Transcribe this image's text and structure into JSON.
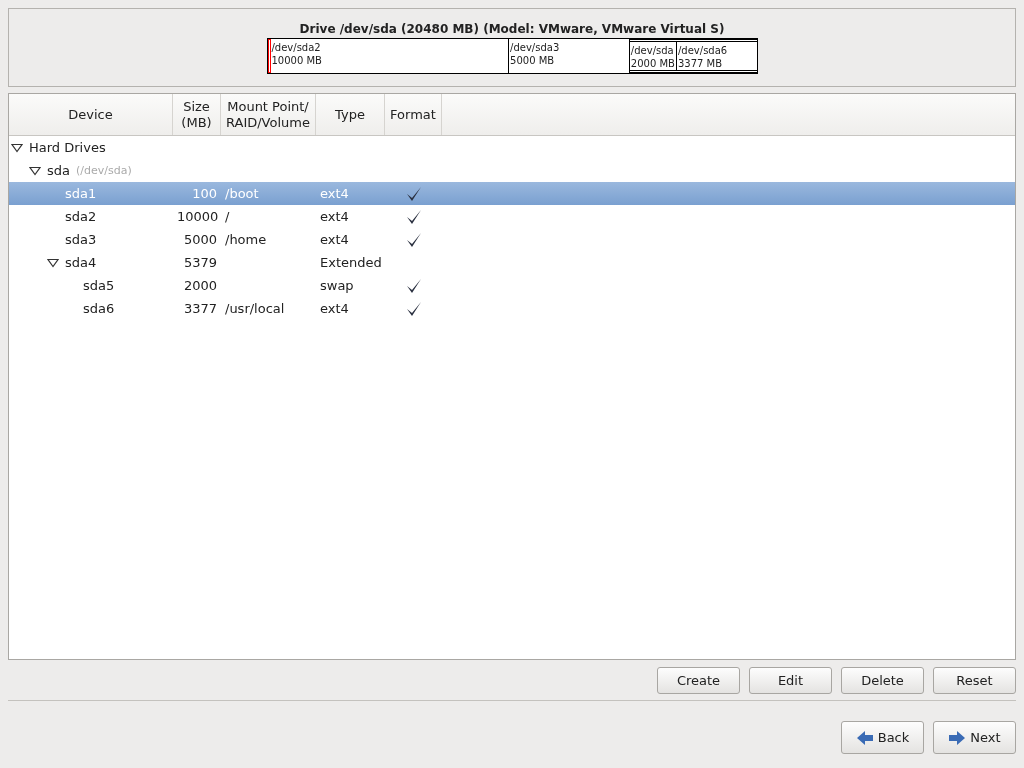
{
  "drive": {
    "title": "Drive /dev/sda (20480 MB) (Model: VMware, VMware Virtual S)",
    "segments": [
      {
        "kind": "partition",
        "selected": true
      },
      {
        "kind": "partition",
        "selected": false,
        "device": "/dev/sda2",
        "size": "10000 MB"
      },
      {
        "kind": "partition",
        "selected": false,
        "device": "/dev/sda3",
        "size": "5000 MB"
      },
      {
        "kind": "extended",
        "selected": false,
        "children": [
          {
            "kind": "partition",
            "selected": false,
            "device": "/dev/sda",
            "size": "2000 MB"
          },
          {
            "kind": "partition",
            "selected": false,
            "device": "/dev/sda6",
            "size": "3377 MB"
          }
        ]
      }
    ]
  },
  "table": {
    "columns": [
      "Device",
      "Size\n(MB)",
      "Mount Point/\nRAID/Volume",
      "Type",
      "Format"
    ],
    "rows": [
      {
        "device": "Hard Drives",
        "expanded": true,
        "selected": false,
        "children": [
          {
            "device": "sda",
            "note": "(/dev/sda)",
            "expanded": true,
            "selected": false,
            "children": [
              {
                "device": "sda1",
                "size": "100",
                "mount": "/boot",
                "type": "ext4",
                "format": true,
                "selected": true
              },
              {
                "device": "sda2",
                "size": "10000",
                "mount": "/",
                "type": "ext4",
                "format": true,
                "selected": false
              },
              {
                "device": "sda3",
                "size": "5000",
                "mount": "/home",
                "type": "ext4",
                "format": true,
                "selected": false
              },
              {
                "device": "sda4",
                "size": "5379",
                "type": "Extended",
                "format": false,
                "expanded": true,
                "selected": false,
                "children": [
                  {
                    "device": "sda5",
                    "size": "2000",
                    "type": "swap",
                    "format": true,
                    "selected": false
                  },
                  {
                    "device": "sda6",
                    "size": "3377",
                    "mount": "/usr/local",
                    "type": "ext4",
                    "format": true,
                    "selected": false
                  }
                ]
              }
            ]
          }
        ]
      }
    ]
  },
  "actions": [
    "Create",
    "Edit",
    "Delete",
    "Reset"
  ],
  "navigation": [
    {
      "label": "Back",
      "kind": "back"
    },
    {
      "label": "Next",
      "kind": "next"
    }
  ]
}
